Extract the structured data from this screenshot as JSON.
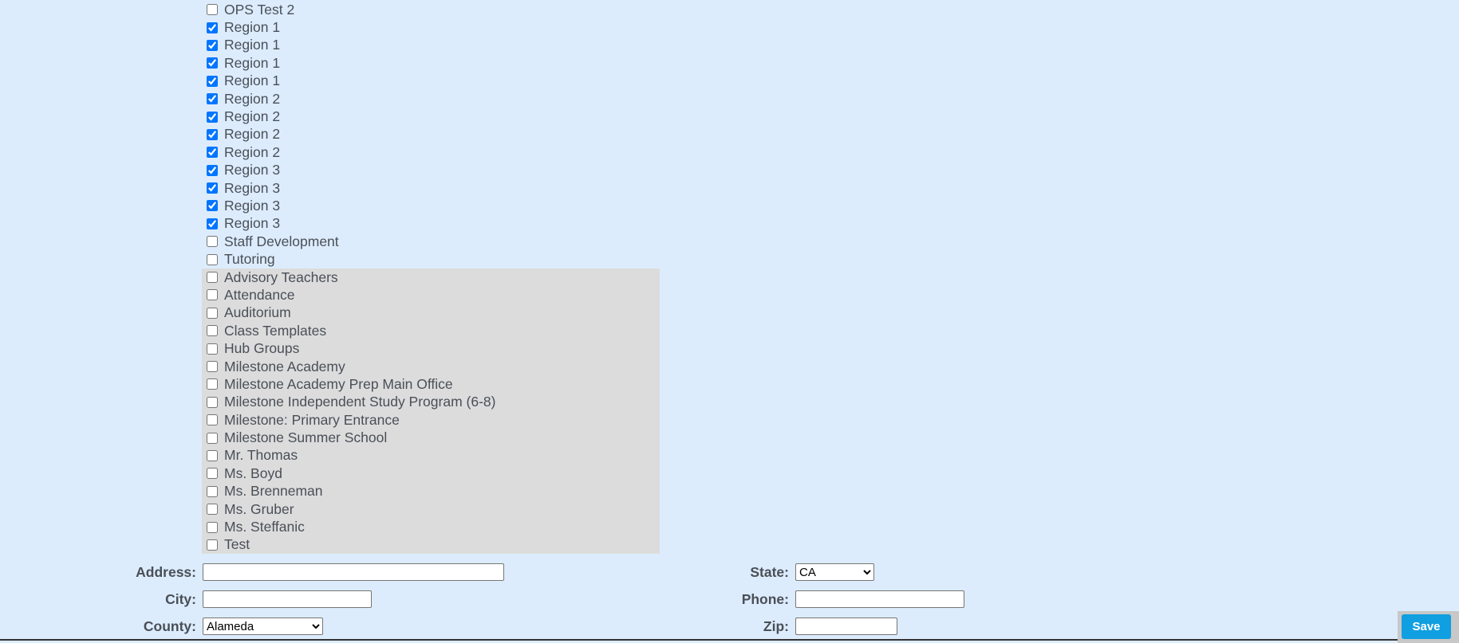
{
  "checklist": {
    "items": [
      {
        "label": "OPS Test 2",
        "checked": false,
        "group": "plain"
      },
      {
        "label": "Region 1",
        "checked": true,
        "group": "plain"
      },
      {
        "label": "Region 1",
        "checked": true,
        "group": "plain"
      },
      {
        "label": "Region 1",
        "checked": true,
        "group": "plain"
      },
      {
        "label": "Region 1",
        "checked": true,
        "group": "plain"
      },
      {
        "label": "Region 2",
        "checked": true,
        "group": "plain"
      },
      {
        "label": "Region 2",
        "checked": true,
        "group": "plain"
      },
      {
        "label": "Region 2",
        "checked": true,
        "group": "plain"
      },
      {
        "label": "Region 2",
        "checked": true,
        "group": "plain"
      },
      {
        "label": "Region 3",
        "checked": true,
        "group": "plain"
      },
      {
        "label": "Region 3",
        "checked": true,
        "group": "plain"
      },
      {
        "label": "Region 3",
        "checked": true,
        "group": "plain"
      },
      {
        "label": "Region 3",
        "checked": true,
        "group": "plain"
      },
      {
        "label": "Staff Development",
        "checked": false,
        "group": "plain"
      },
      {
        "label": "Tutoring",
        "checked": false,
        "group": "plain"
      },
      {
        "label": "Advisory Teachers",
        "checked": false,
        "group": "gray"
      },
      {
        "label": "Attendance",
        "checked": false,
        "group": "gray"
      },
      {
        "label": "Auditorium",
        "checked": false,
        "group": "gray"
      },
      {
        "label": "Class Templates",
        "checked": false,
        "group": "gray"
      },
      {
        "label": "Hub Groups",
        "checked": false,
        "group": "gray"
      },
      {
        "label": "Milestone Academy",
        "checked": false,
        "group": "gray"
      },
      {
        "label": "Milestone Academy Prep Main Office",
        "checked": false,
        "group": "gray"
      },
      {
        "label": "Milestone Independent Study Program (6-8)",
        "checked": false,
        "group": "gray"
      },
      {
        "label": "Milestone: Primary Entrance",
        "checked": false,
        "group": "gray"
      },
      {
        "label": "Milestone Summer School",
        "checked": false,
        "group": "gray"
      },
      {
        "label": "Mr. Thomas",
        "checked": false,
        "group": "gray"
      },
      {
        "label": "Ms. Boyd",
        "checked": false,
        "group": "gray"
      },
      {
        "label": "Ms. Brenneman",
        "checked": false,
        "group": "gray"
      },
      {
        "label": "Ms. Gruber",
        "checked": false,
        "group": "gray"
      },
      {
        "label": "Ms. Steffanic",
        "checked": false,
        "group": "gray"
      },
      {
        "label": "Test",
        "checked": false,
        "group": "gray"
      }
    ]
  },
  "form": {
    "address": {
      "label": "Address:",
      "value": ""
    },
    "city": {
      "label": "City:",
      "value": ""
    },
    "county": {
      "label": "County:",
      "value": "Alameda"
    },
    "state": {
      "label": "State:",
      "value": "CA"
    },
    "phone": {
      "label": "Phone:",
      "value": ""
    },
    "zip": {
      "label": "Zip:",
      "value": ""
    }
  },
  "actions": {
    "save_label": "Save"
  },
  "colors": {
    "page_background": "#dcecfd",
    "group_background": "#dcdcdc",
    "save_button": "#109fe0"
  }
}
